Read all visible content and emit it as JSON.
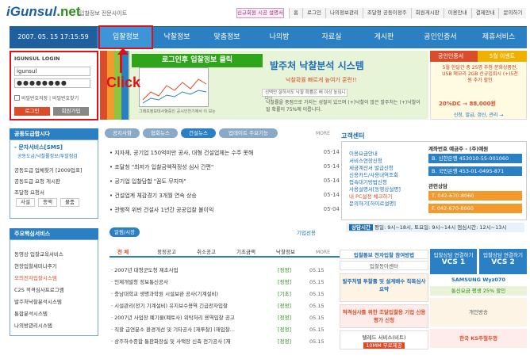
{
  "header": {
    "logo_main": "Gunsul",
    "logo_i": "i",
    "logo_tld": ".net",
    "logo_sub": "입찰정보 전문사이트",
    "promo": "신규회원 시공 설명서",
    "links": [
      "홈",
      "로그인",
      "나의정보관리",
      "조달청 공동이정주",
      "회원게시판",
      "이용안내",
      "결제안내",
      "문의하기"
    ]
  },
  "nav": {
    "date": "2007. 05. 15  17:15:59",
    "items": [
      "입찰정보",
      "낙찰정보",
      "맞춤정보",
      "나의방",
      "자료실",
      "게시판",
      "공인인증서",
      "제휴서비스"
    ]
  },
  "login": {
    "title": "IGUNSUL LOGIN",
    "id_value": "igunsul",
    "pw_value": "●●●●●●●●",
    "save_id": "비밀번호저장",
    "find_pw": "비밀번호찾기",
    "login_button": "로그인",
    "join_button": "회원가입"
  },
  "annotation": {
    "green_label": "로그인후 입찰정보 클릭",
    "click_label": "Click"
  },
  "hero": {
    "title": "발주처 낙찰분석 시스템",
    "subtitle": "낙찰확률 빠르게 높여가 훈련!!",
    "search_placeholder": "선택만 잘하셔도 낙찰 확률은 배 이상 높임니다!!",
    "desc": "낙찰률을 중점으로 가지는 성질이 있으며 (+)낙찰이 많은 발주처는 (+)낙찰이 될 확률이 75%에 이릅니다.",
    "chart_caption": "그래프정보대사항중인 공시인천기에서 이 보는"
  },
  "cert_ad": {
    "head_left": "공인인증서",
    "head_right": "5월 이벤트",
    "text": "5월 한달간 총 25명 추첨 문화상품권, USB 메모리 2GB 신규입회시 (+)5천원 추가 할인",
    "price": "20%DC → 88,000원",
    "footer": "신청, 발급, 갱신, 관리 →"
  },
  "left_side": {
    "head1": "공동도급합시다",
    "sms_title": "- 문자서비스[SMS]",
    "sms_sub": "공동도급/낙찰률정보/투발점검",
    "items1": [
      "공동도급 업체찾기 [2009업표]",
      "공동도급 요청 게시판",
      "조달청 요청서"
    ],
    "tags": [
      "사설",
      "종액",
      "물품"
    ],
    "head2": "주요핵심서비스",
    "items2": [
      "동영상 입찰교육서비스",
      "현장입찰세미나추기",
      "모의전자입찰시스템",
      "C2S 적격심사프로그램",
      "발주처낙찰분석시스템",
      "통합분석시스템",
      "나의방관리시스템"
    ]
  },
  "news": {
    "tabs": [
      "공지사항",
      "협회뉴스",
      "건설뉴스",
      "업데이트 주요기능"
    ],
    "more": "MORE",
    "rows": [
      {
        "text": "지자체, 공기업 150억미만 공사, 대형 건설업체는 수주 못해",
        "date": "05-14"
      },
      {
        "text": "조달청 \"최저가 입찰금액적정성 심사 간편\"",
        "date": "05-14"
      },
      {
        "text": "공기업 입찰담합 \"꼼도 무지마\"",
        "date": "05-14"
      },
      {
        "text": "건설업계 체감경기 3개월 연속 상승",
        "date": "05-14"
      },
      {
        "text": "관행적 위반 건설사 1년간 공공입찰 불이익",
        "date": "05-04"
      }
    ]
  },
  "customer": {
    "head": "고객센터",
    "links": [
      "이용요금안내",
      "서비스연장신청",
      "세금계산서 발급신청",
      "신용카드/사용내역조회",
      "접속대기방법신청",
      "사용설명서[동영상설명]",
      "내 PC설정 체크하기",
      "문의하기[하이로설명]"
    ],
    "bank_title": "계좌번호 예금주 - (주)예원",
    "banks": [
      "B. 신한은행 453010-55-001060",
      "B. 국민은행 453-01-0495-871"
    ],
    "contact_title": "관련상담",
    "tel": "T. 042-670-8060",
    "fax": "F. 042-670-8060",
    "hours_label": "상담시간",
    "hours": "평일: 9시~18시, 토요일: 9시~14시 점심시간: 12시~13시"
  },
  "list": {
    "tab": "알림/시장",
    "link": "기업선용",
    "categories": [
      "전 체",
      "정정공고",
      "취소공고",
      "기초금액",
      "낙찰정보"
    ],
    "more": "MORE",
    "rows": [
      {
        "text": "2007년 대청군도청 제초사업",
        "cat": "[정정]",
        "date": "05.15"
      },
      {
        "text": "인제개발청 정보통신공사",
        "cat": "[정정]",
        "date": "05.15"
      },
      {
        "text": "충남대학교 생명과학원 시설보완 공사(기계설비)",
        "cat": "[기초]",
        "date": "05.15"
      },
      {
        "text": "시설관리(전기 기계설비) 유지보수용역 긴급전자입찰",
        "cat": "[정정]",
        "date": "05.15"
      },
      {
        "text": "2007년 사업장 폐기물(폐토사) 위탁처리 용역입찰 공고",
        "cat": "[정정]",
        "date": "05.15"
      },
      {
        "text": "직할 급연분소 환경개선 및 기타공사 [재투찰] (재입찰...",
        "cat": "[정정]",
        "date": "05.15"
      },
      {
        "text": "상주하수종합 통판화장실 및 사택장 신축 전기공사 [재",
        "cat": "[정정]",
        "date": "05.15"
      }
    ]
  },
  "right_ads": {
    "e_bid": "입찰통보 전자입찰 참여방법",
    "e_bid2": "입찰동아센터",
    "vcs_left_top": "입찰상담 연결하기",
    "vcs_left": "VCS 1",
    "vcs_right_top": "입찰상담 연결하기",
    "vcs_right": "VCS 2",
    "analysis": "발주처별 투찰률 및 설계배수 직목심사요약",
    "reports": "적격심사를 위한 조달입찰용 기업 신용평가 신청",
    "tech": "텔레드 서비스(비트)",
    "tech2": "10MM 무료제공",
    "samsung": "SAMSUNG Wyz070",
    "mobile": "통신요금 평생 25% 할인",
    "personal": "개인방송",
    "kit": "한국 KS주철두껑"
  }
}
